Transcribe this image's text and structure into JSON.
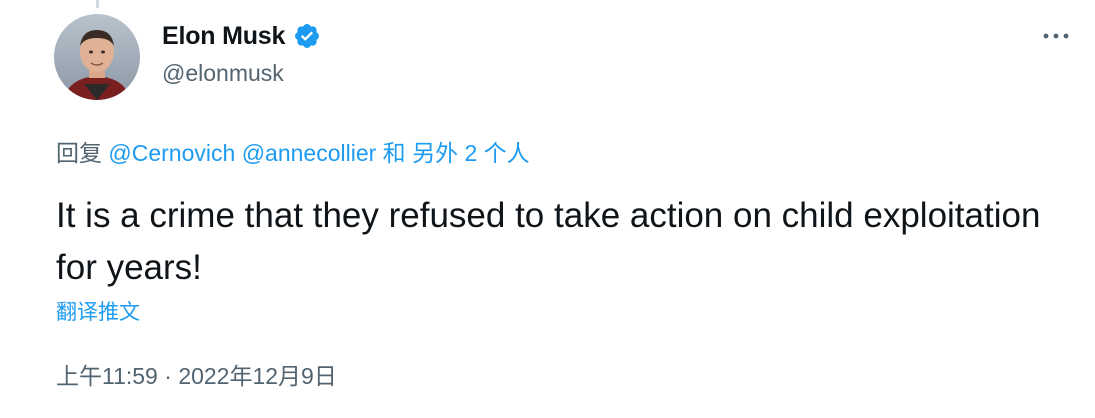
{
  "author": {
    "display_name": "Elon Musk",
    "handle": "@elonmusk",
    "verified": true
  },
  "reply_context": {
    "prefix": "回复",
    "mentions": [
      "@Cernovich",
      "@annecollier"
    ],
    "conjunction": "和",
    "others": "另外 2 个人"
  },
  "tweet": {
    "text": "It is a crime that they refused to take action on child exploitation for years!",
    "translate_label": "翻译推文"
  },
  "meta": {
    "time": "上午11:59",
    "separator": "·",
    "date": "2022年12月9日"
  },
  "icons": {
    "verified": "verified-badge-icon",
    "more": "more-dots-icon"
  },
  "colors": {
    "link": "#1d9bf0",
    "secondary_text": "#536471",
    "primary_text": "#0f1419",
    "verified": "#1d9bf0"
  }
}
